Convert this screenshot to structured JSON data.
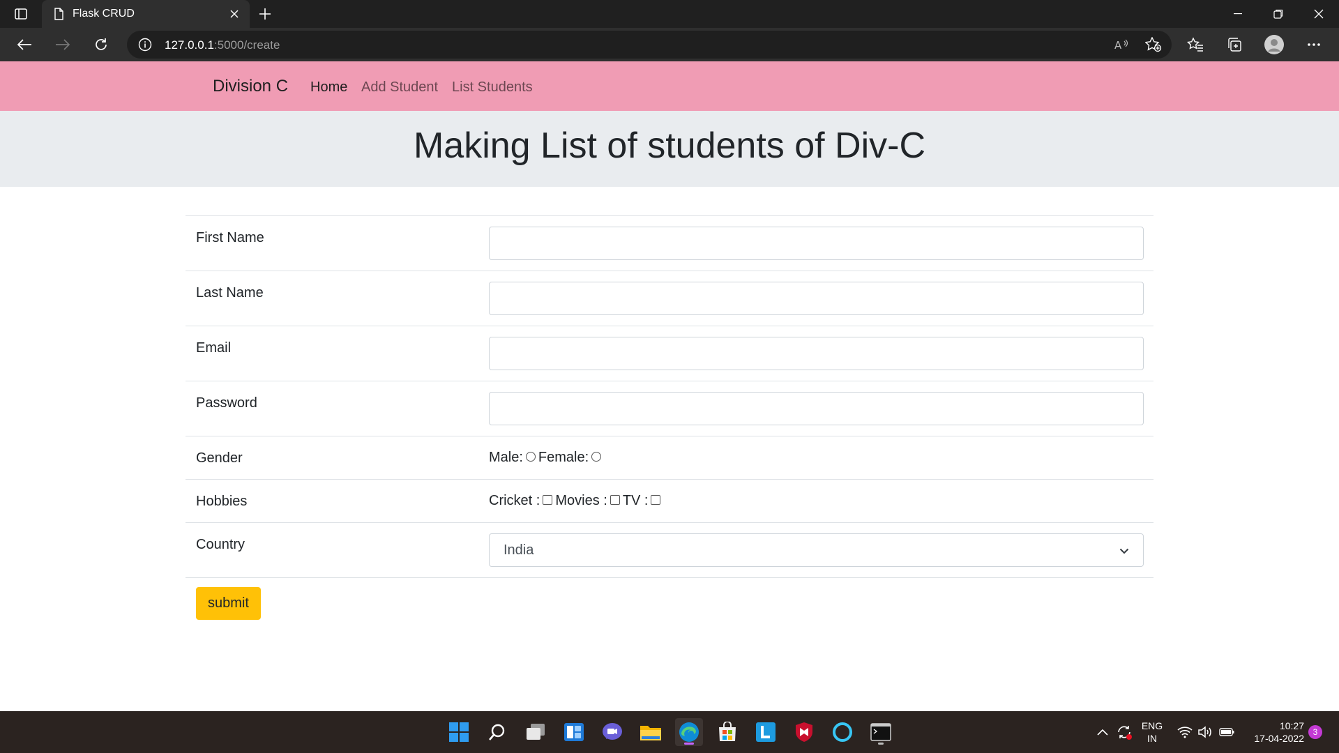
{
  "browser": {
    "tab_title": "Flask CRUD",
    "url_host": "127.0.0.1",
    "url_rest": ":5000/create"
  },
  "navbar": {
    "brand": "Division C",
    "links": [
      "Home",
      "Add Student",
      "List Students"
    ],
    "active_index": 0,
    "background": "#f09cb4"
  },
  "header": {
    "title": "Making List of students of Div-C"
  },
  "form": {
    "first_name_label": "First Name",
    "first_name_value": "",
    "last_name_label": "Last Name",
    "last_name_value": "",
    "email_label": "Email",
    "email_value": "",
    "password_label": "Password",
    "password_value": "",
    "gender_label": "Gender",
    "gender_options": [
      "Male:",
      "Female:"
    ],
    "hobbies_label": "Hobbies",
    "hobby_options": [
      "Cricket :",
      "Movies :",
      "TV :"
    ],
    "country_label": "Country",
    "country_selected": "India",
    "submit_label": "submit",
    "submit_color": "#ffc107"
  },
  "taskbar": {
    "language": "ENG",
    "region": "IN",
    "time": "10:27",
    "date": "17-04-2022",
    "notification_count": "3",
    "apps": [
      "start-icon",
      "search-icon",
      "task-view-icon",
      "widgets-icon",
      "teams-chat-icon",
      "file-explorer-icon",
      "edge-icon",
      "store-icon",
      "lens-app-icon",
      "mcafee-icon",
      "cortana-icon",
      "terminal-icon"
    ]
  }
}
